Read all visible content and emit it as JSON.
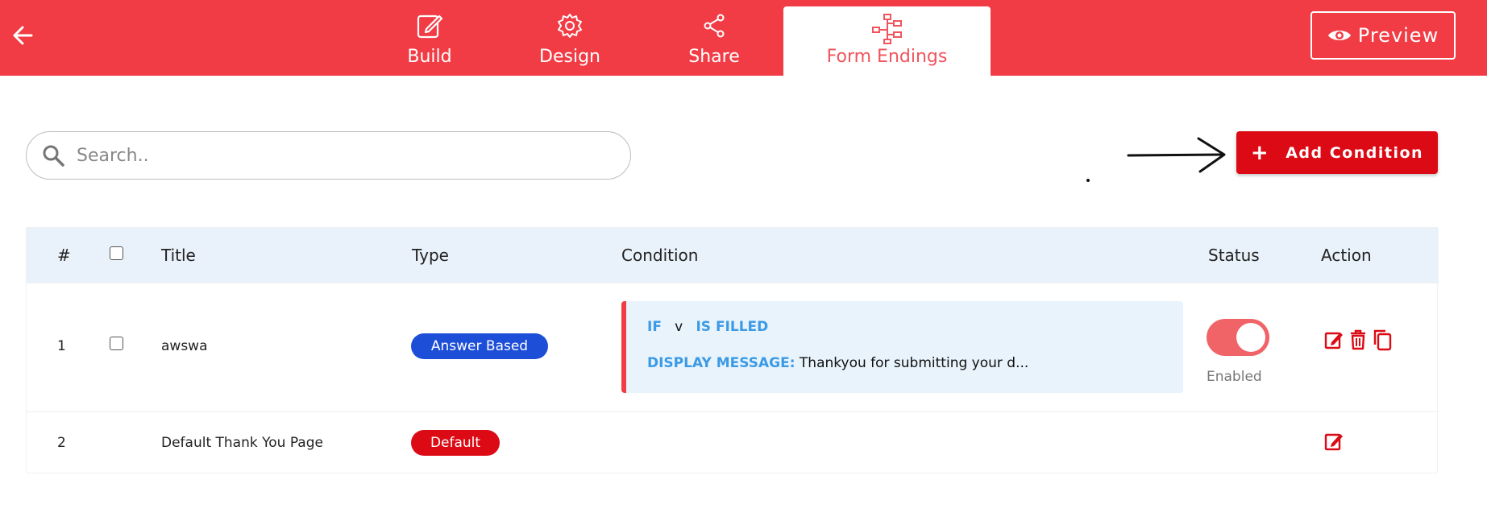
{
  "header": {
    "tabs": [
      {
        "label": "Build",
        "icon": "edit-icon"
      },
      {
        "label": "Design",
        "icon": "gear-icon"
      },
      {
        "label": "Share",
        "icon": "share-icon"
      },
      {
        "label": "Form Endings",
        "icon": "flowchart-icon",
        "active": true
      }
    ],
    "preview_label": "Preview",
    "bar_color": "#f23c45"
  },
  "search": {
    "placeholder": "Search.."
  },
  "toolbar": {
    "add_condition_label": "Add Condition",
    "add_icon": "+",
    "button_color": "#dc0a14"
  },
  "table": {
    "headers": [
      "#",
      "",
      "Title",
      "Type",
      "Condition",
      "Status",
      "Action"
    ],
    "rows": [
      {
        "num": "1",
        "title": "awswa",
        "type": "Answer Based",
        "condition": {
          "if_label": "IF",
          "field": "v",
          "operator": "IS FILLED",
          "message_label": "DISPLAY MESSAGE:",
          "message": "Thankyou for submitting your d..."
        },
        "status": {
          "enabled": true,
          "label": "Enabled"
        },
        "actions": [
          "edit-icon",
          "trash-icon",
          "copy-icon"
        ]
      },
      {
        "num": "2",
        "title": "Default Thank You Page",
        "type": "Default",
        "actions": [
          "edit-icon"
        ]
      }
    ]
  },
  "colors": {
    "answer_badge": "#1d4ed8",
    "default_badge": "#dc0a14",
    "toggle_on": "#f06468",
    "condition_key": "#3b9ae5"
  }
}
